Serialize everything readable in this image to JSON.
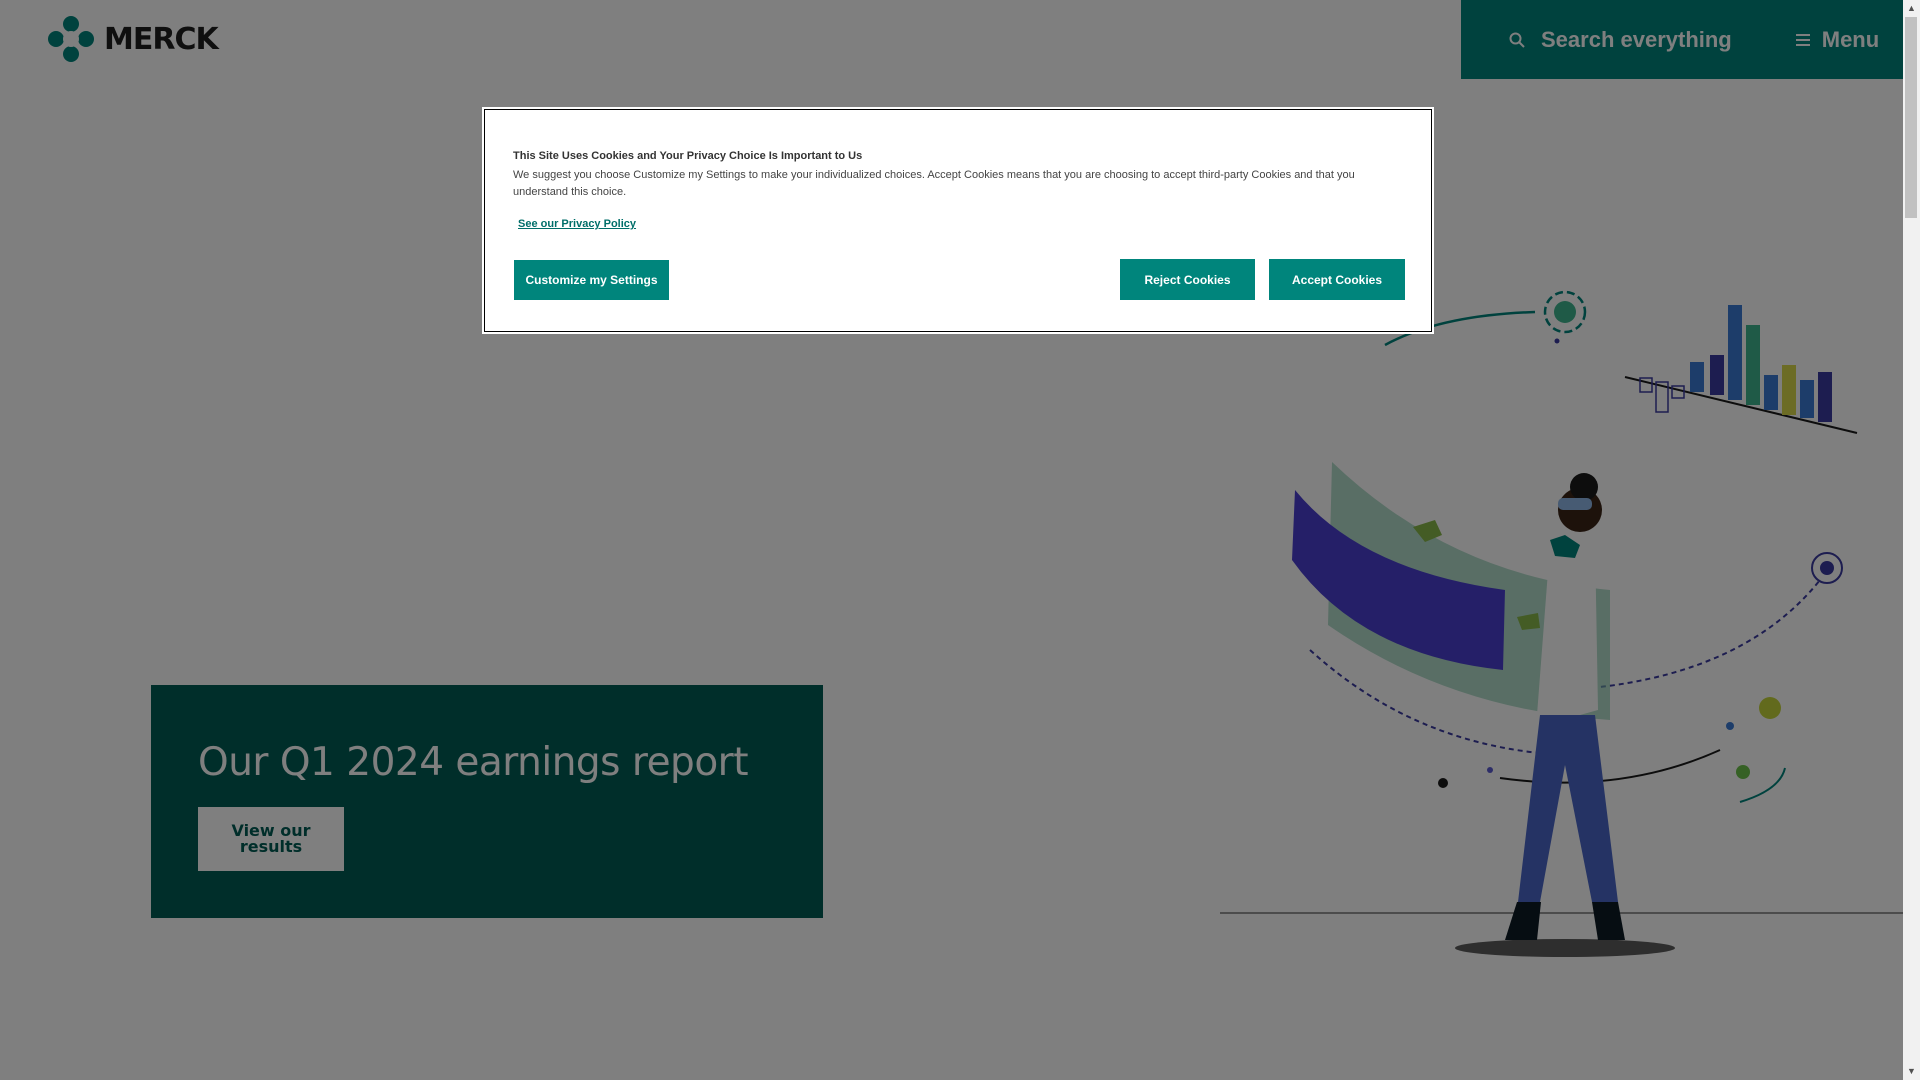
{
  "header": {
    "logo_text": "MERCK",
    "search_label": "Search everything",
    "menu_label": "Menu",
    "search_icon": "search-icon",
    "menu_icon": "hamburger-icon"
  },
  "hero": {
    "title": "Our Q1 2024 earnings report",
    "button_label": "View our results"
  },
  "cookie_dialog": {
    "title": "This Site Uses Cookies and Your Privacy Choice Is Important to Us",
    "text": "We suggest you choose Customize my Settings to make your individualized choices. Accept Cookies means that you are choosing to accept third-party Cookies and that you understand this choice.",
    "privacy_link": "See our Privacy Policy",
    "customize_label": "Customize my Settings",
    "reject_label": "Reject Cookies",
    "accept_label": "Accept Cookies"
  },
  "colors": {
    "brand_teal": "#00857c",
    "dark_teal": "#005c55",
    "overlay": "rgba(0,0,0,0.5)"
  }
}
